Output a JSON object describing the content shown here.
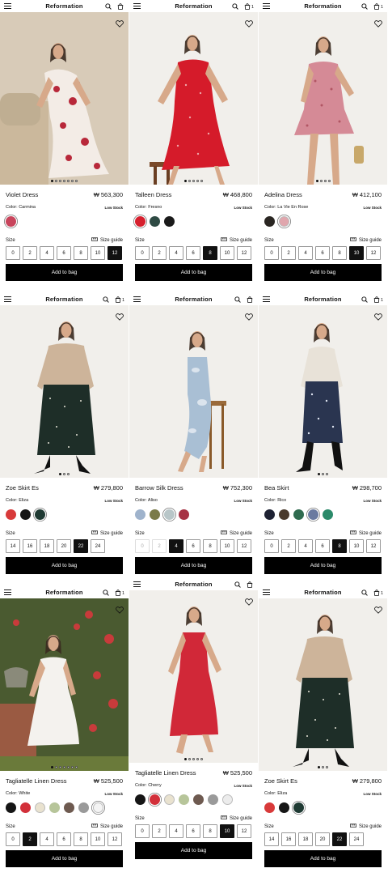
{
  "cards": [
    {
      "brand": "Reformation",
      "bag_count": "",
      "name": "Violet Dress",
      "price": "₩ 563,300",
      "color_label": "Color:",
      "color_name": "Carmina",
      "stock": "Low Stock",
      "size_label": "Size",
      "size_guide": "Size guide",
      "sizes": [
        "0",
        "2",
        "4",
        "6",
        "8",
        "10",
        "12"
      ],
      "selected_size": "12",
      "unavailable": [],
      "add_label": "Add to bag",
      "swatches": [
        "#c8455c"
      ],
      "selected_swatch": 0,
      "dots": 7,
      "active_dot": 0,
      "bg": "#d8cbb8",
      "figure": "dress-floral-cream"
    },
    {
      "brand": "Reformation",
      "bag_count": "1",
      "name": "Talleen Dress",
      "price": "₩ 468,800",
      "color_label": "Color:",
      "color_name": "Fresno",
      "stock": "Low Stock",
      "size_label": "Size",
      "size_guide": "Size guide",
      "sizes": [
        "0",
        "2",
        "4",
        "6",
        "8",
        "10",
        "12"
      ],
      "selected_size": "8",
      "unavailable": [],
      "add_label": "Add to bag",
      "swatches": [
        "#d6202e",
        "#2e4a44",
        "#1a1a1a"
      ],
      "selected_swatch": 0,
      "dots": 5,
      "active_dot": 0,
      "bg": "#f1efeb",
      "figure": "dress-red"
    },
    {
      "brand": "Reformation",
      "bag_count": "1",
      "name": "Adelina Dress",
      "price": "₩ 412,100",
      "color_label": "Color:",
      "color_name": "La Vie En Rose",
      "stock": "Low Stock",
      "size_label": "Size",
      "size_guide": "Size guide",
      "sizes": [
        "0",
        "2",
        "4",
        "6",
        "8",
        "10",
        "12"
      ],
      "selected_size": "10",
      "unavailable": [],
      "add_label": "Add to bag",
      "swatches": [
        "#2a2622",
        "#e0a6ad"
      ],
      "selected_swatch": 1,
      "dots": 4,
      "active_dot": 0,
      "bg": "#f1efeb",
      "figure": "dress-pink-short"
    },
    {
      "brand": "Reformation",
      "bag_count": "1",
      "name": "Zoe Skirt Es",
      "price": "₩ 279,800",
      "color_label": "Color:",
      "color_name": "Eliza",
      "stock": "Low Stock",
      "size_label": "Size",
      "size_guide": "Size guide",
      "sizes": [
        "14",
        "16",
        "18",
        "20",
        "22",
        "24"
      ],
      "selected_size": "22",
      "unavailable": [],
      "add_label": "Add to bag",
      "swatches": [
        "#d83a3a",
        "#161616",
        "#1f3a33"
      ],
      "selected_swatch": 2,
      "dots": 3,
      "active_dot": 0,
      "bg": "#f1efeb",
      "figure": "skirt-green"
    },
    {
      "brand": "Reformation",
      "bag_count": "",
      "name": "Barrow Silk Dress",
      "price": "₩ 752,300",
      "color_label": "Color:",
      "color_name": "Aliso",
      "stock": "Low Stock",
      "size_label": "Size",
      "size_guide": "Size guide",
      "sizes": [
        "0",
        "2",
        "4",
        "6",
        "8",
        "10",
        "12"
      ],
      "selected_size": "4",
      "unavailable": [
        "0",
        "2"
      ],
      "add_label": "Add to bag",
      "swatches": [
        "#9fb3cc",
        "#7a7a48",
        "#b8c6c8",
        "#a63244"
      ],
      "selected_swatch": 2,
      "dots": 0,
      "active_dot": 0,
      "bg": "#f1efeb",
      "figure": "dress-blue-silk"
    },
    {
      "brand": "Reformation",
      "bag_count": "1",
      "name": "Bea Skirt",
      "price": "₩ 298,700",
      "color_label": "Color:",
      "color_name": "Rico",
      "stock": "Low Stock",
      "size_label": "Size",
      "size_guide": "Size guide",
      "sizes": [
        "0",
        "2",
        "4",
        "6",
        "8",
        "10",
        "12"
      ],
      "selected_size": "8",
      "unavailable": [],
      "add_label": "Add to bag",
      "swatches": [
        "#1e2233",
        "#4a3a2c",
        "#2f6b4f",
        "#6a7aa0",
        "#2b8a6a"
      ],
      "selected_swatch": 3,
      "dots": 3,
      "active_dot": 0,
      "bg": "#f1efeb",
      "figure": "skirt-navy"
    },
    {
      "brand": "Reformation",
      "bag_count": "1",
      "name": "Tagliatelle Linen Dress",
      "price": "₩ 525,500",
      "color_label": "Color:",
      "color_name": "White",
      "stock": "Low Stock",
      "size_label": "Size",
      "size_guide": "Size guide",
      "sizes": [
        "0",
        "2",
        "4",
        "6",
        "8",
        "10",
        "12"
      ],
      "selected_size": "2",
      "unavailable": [],
      "add_label": "Add to bag",
      "swatches": [
        "#151515",
        "#d2303a",
        "#e9e2cf",
        "#b7c59a",
        "#6e5a50",
        "#9a9a9a",
        "#f4f4f4"
      ],
      "selected_swatch": 6,
      "dots": 7,
      "active_dot": 0,
      "bg": "#5a6a3a",
      "figure": "dress-white-garden"
    },
    {
      "brand": "Reformation",
      "bag_count": "",
      "name": "Tagliatelle Linen Dress",
      "price": "₩ 525,500",
      "color_label": "Color:",
      "color_name": "Cherry",
      "stock": "Low Stock",
      "size_label": "Size",
      "size_guide": "Size guide",
      "sizes": [
        "0",
        "2",
        "4",
        "6",
        "8",
        "10",
        "12"
      ],
      "selected_size": "10",
      "unavailable": [],
      "add_label": "Add to bag",
      "swatches": [
        "#151515",
        "#d2303a",
        "#e9e2cf",
        "#b7c59a",
        "#6e5a50",
        "#9a9a9a",
        "#ececec"
      ],
      "selected_swatch": 1,
      "dots": 5,
      "active_dot": 0,
      "bg": "#f1efeb",
      "figure": "dress-red-midi"
    },
    {
      "brand": "Reformation",
      "bag_count": "1",
      "name": "Zoe Skirt Es",
      "price": "₩ 279,800",
      "color_label": "Color:",
      "color_name": "Eliza",
      "stock": "Low Stock",
      "size_label": "Size",
      "size_guide": "Size guide",
      "sizes": [
        "14",
        "16",
        "18",
        "20",
        "22",
        "24"
      ],
      "selected_size": "22",
      "unavailable": [],
      "add_label": "Add to bag",
      "swatches": [
        "#d83a3a",
        "#161616",
        "#1f3a33"
      ],
      "selected_swatch": 2,
      "dots": 3,
      "active_dot": 0,
      "bg": "#f1efeb",
      "figure": "skirt-green"
    }
  ]
}
